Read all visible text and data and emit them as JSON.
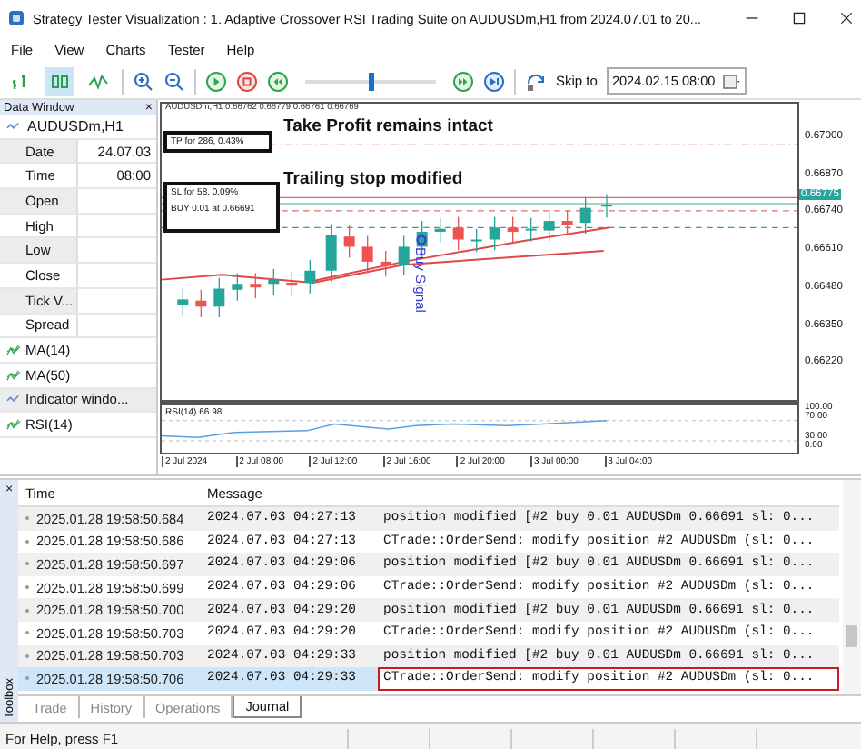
{
  "window": {
    "title": "Strategy Tester Visualization : 1. Adaptive Crossover RSI Trading Suite on AUDUSDm,H1 from 2024.07.01 to 20..."
  },
  "menu": [
    "File",
    "View",
    "Charts",
    "Tester",
    "Help"
  ],
  "toolbar": {
    "chart_modes": [
      {
        "selected": false
      },
      {
        "selected": true
      },
      {
        "selected": false
      }
    ],
    "speed": {
      "level": 0.5
    },
    "skip_label": "Skip to",
    "skip_date": "2024.02.15 08:00"
  },
  "data_window": {
    "title": "Data Window",
    "close": "×",
    "symbol": "AUDUSDm,H1",
    "fields": [
      {
        "label": "Date",
        "value": "24.07.03"
      },
      {
        "label": "Time",
        "value": "08:00"
      },
      {
        "label": "Open"
      },
      {
        "label": "High"
      },
      {
        "label": "Low"
      },
      {
        "label": "Close"
      },
      {
        "label": "Tick V..."
      },
      {
        "label": "Spread"
      }
    ],
    "indicators": [
      {
        "name": "MA(14)",
        "kind": "indicator"
      },
      {
        "name": "MA(50)",
        "kind": "indicator"
      },
      {
        "name": "Indicator windo...",
        "kind": "window"
      },
      {
        "name": "RSI(14)",
        "kind": "indicator"
      }
    ]
  },
  "chart": {
    "header": "AUDUSDm,H1  0.66762 0.66779 0.66761 0.66769",
    "tp_box": "TP for 286, 0.43%",
    "tp_note": "Take Profit remains intact",
    "sl_box": [
      "SL for 58, 0.09%",
      "BUY 0.01 at 0.66691"
    ],
    "sl_note": "Trailing stop modified",
    "signal": "Buy Signal",
    "price_ticks": [
      "0.67000",
      "0.66870",
      "0.66740",
      "0.66610",
      "0.66480",
      "0.66350",
      "0.66220"
    ],
    "current_price": "0.66775",
    "rsi_label": "RSI(14) 66.98",
    "rsi_ticks": [
      "100.00",
      "70.00",
      "30.00",
      "0.00"
    ],
    "time_ticks": [
      "2 Jul 2024",
      "2 Jul 08:00",
      "2 Jul 12:00",
      "2 Jul 16:00",
      "2 Jul 20:00",
      "3 Jul 00:00",
      "3 Jul 04:00"
    ]
  },
  "journal": {
    "side_label": "Toolbox",
    "close": "×",
    "columns": [
      "Time",
      "Message"
    ],
    "rows": [
      {
        "time": "2025.01.28 19:58:50.684",
        "date": "2024.07.03 04:27:13",
        "message": "position modified [#2 buy 0.01 AUDUSDm 0.66691 sl: 0...",
        "selected": false,
        "highlighted": false
      },
      {
        "time": "2025.01.28 19:58:50.686",
        "date": "2024.07.03 04:27:13",
        "message": "CTrade::OrderSend: modify position #2 AUDUSDm (sl: 0...",
        "selected": false,
        "highlighted": false
      },
      {
        "time": "2025.01.28 19:58:50.697",
        "date": "2024.07.03 04:29:06",
        "message": "position modified [#2 buy 0.01 AUDUSDm 0.66691 sl: 0...",
        "selected": false,
        "highlighted": false
      },
      {
        "time": "2025.01.28 19:58:50.699",
        "date": "2024.07.03 04:29:06",
        "message": "CTrade::OrderSend: modify position #2 AUDUSDm (sl: 0...",
        "selected": false,
        "highlighted": false
      },
      {
        "time": "2025.01.28 19:58:50.700",
        "date": "2024.07.03 04:29:20",
        "message": "position modified [#2 buy 0.01 AUDUSDm 0.66691 sl: 0...",
        "selected": false,
        "highlighted": false
      },
      {
        "time": "2025.01.28 19:58:50.703",
        "date": "2024.07.03 04:29:20",
        "message": "CTrade::OrderSend: modify position #2 AUDUSDm (sl: 0...",
        "selected": false,
        "highlighted": false
      },
      {
        "time": "2025.01.28 19:58:50.703",
        "date": "2024.07.03 04:29:33",
        "message": "position modified [#2 buy 0.01 AUDUSDm 0.66691 sl: 0...",
        "selected": false,
        "highlighted": false
      },
      {
        "time": "2025.01.28 19:58:50.706",
        "date": "2024.07.03 04:29:33",
        "message": "CTrade::OrderSend: modify position #2 AUDUSDm (sl: 0...",
        "selected": true,
        "highlighted": true
      }
    ],
    "tabs": [
      {
        "label": "Trade",
        "selected": false
      },
      {
        "label": "History",
        "selected": false
      },
      {
        "label": "Operations",
        "selected": false
      },
      {
        "label": "Journal",
        "selected": true
      }
    ]
  },
  "status_bar": {
    "text": "For Help, press F1"
  }
}
